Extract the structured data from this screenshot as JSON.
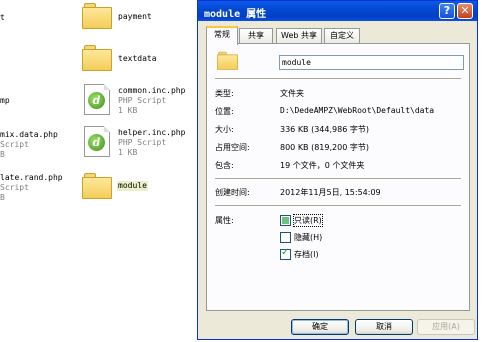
{
  "explorer": {
    "items": [
      {
        "name": "payment",
        "kind": "folder"
      },
      {
        "name": "textdata",
        "kind": "folder"
      },
      {
        "name": "common.inc.php",
        "type": "PHP Script",
        "size": "1 KB",
        "kind": "php"
      },
      {
        "name": "helper.inc.php",
        "type": "PHP Script",
        "size": "1 KB",
        "kind": "php"
      },
      {
        "name": "module",
        "kind": "folder"
      }
    ],
    "partial": {
      "t1": "t",
      "t2": "mp",
      "t3": "mix.data.php",
      "t4": "Script",
      "t5": "B",
      "t6": "late.rand.php",
      "t7": "Script",
      "t8": "B"
    }
  },
  "dialog": {
    "title": "module 属性",
    "help_glyph": "?",
    "close_glyph": "✕",
    "tabs": [
      "常规",
      "共享",
      "Web 共享",
      "自定义"
    ],
    "folder_name": "module",
    "labels": {
      "type": "类型:",
      "location": "位置:",
      "size": "大小:",
      "size_on_disk": "占用空间:",
      "contains": "包含:",
      "created": "创建时间:",
      "attributes": "属性:"
    },
    "values": {
      "type": "文件夹",
      "location": "D:\\DedeAMPZ\\WebRoot\\Default\\data",
      "size": "336 KB (344,986 字节)",
      "size_on_disk": "800 KB (819,200 字节)",
      "contains": "19 个文件，0 个文件夹",
      "created": "2012年11月5日, 15:54:09"
    },
    "attributes": {
      "readonly": "只读(R)",
      "hidden": "隐藏(H)",
      "archive": "存档(I)"
    },
    "buttons": {
      "ok": "确定",
      "cancel": "取消",
      "apply": "应用(A)"
    }
  }
}
